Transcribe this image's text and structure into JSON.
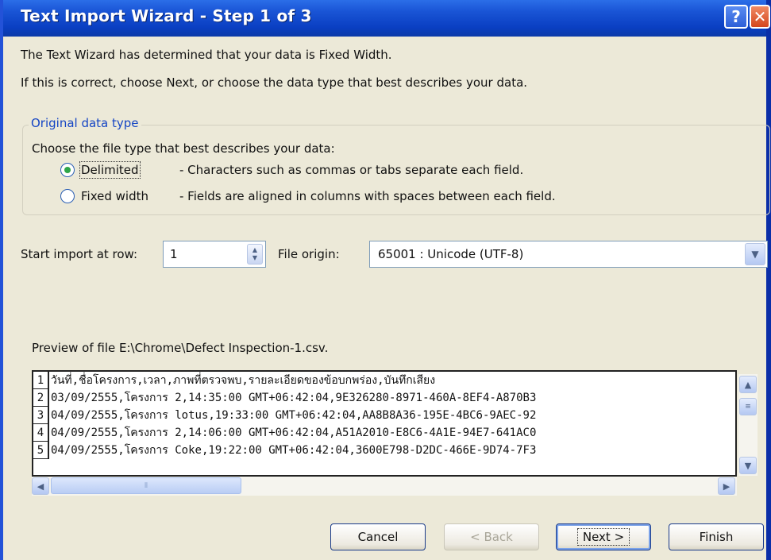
{
  "window": {
    "title": "Text Import Wizard - Step 1 of 3",
    "help_glyph": "?",
    "close_glyph": "✕"
  },
  "intro": {
    "line1": "The Text Wizard has determined that your data is Fixed Width.",
    "line2": "If this is correct, choose Next, or choose the data type that best describes your data."
  },
  "original_data_type": {
    "legend": "Original data type",
    "prompt": "Choose the file type that best describes your data:",
    "options": [
      {
        "label": "Delimited",
        "description": "- Characters such as commas or tabs separate each field.",
        "selected": true
      },
      {
        "label": "Fixed width",
        "description": "- Fields are aligned in columns with spaces between each field.",
        "selected": false
      }
    ]
  },
  "start_row": {
    "label": "Start import at row:",
    "value": "1"
  },
  "file_origin": {
    "label": "File origin:",
    "value": "65001 : Unicode (UTF-8)"
  },
  "preview": {
    "label": "Preview of file E:\\Chrome\\Defect Inspection-1.csv.",
    "rows": [
      {
        "num": "1",
        "text": "วันที่,ชื่อโครงการ,เวลา,ภาพที่ตรวจพบ,รายละเอียดของข้อบกพร่อง,บันทึกเสียง"
      },
      {
        "num": "2",
        "text": "03/09/2555,โครงการ 2,14:35:00 GMT+06:42:04,9E326280-8971-460A-8EF4-A870B3"
      },
      {
        "num": "3",
        "text": "04/09/2555,โครงการ lotus,19:33:00 GMT+06:42:04,AA8B8A36-195E-4BC6-9AEC-92"
      },
      {
        "num": "4",
        "text": "04/09/2555,โครงการ 2,14:06:00 GMT+06:42:04,A51A2010-E8C6-4A1E-94E7-641AC0"
      },
      {
        "num": "5",
        "text": "04/09/2555,โครงการ Coke,19:22:00 GMT+06:42:04,3600E798-D2DC-466E-9D74-7F3"
      }
    ]
  },
  "buttons": {
    "cancel": "Cancel",
    "back": "< Back",
    "next": "Next >",
    "finish": "Finish"
  },
  "colors": {
    "title_bar": "#0a3fc2",
    "dialog_bg": "#ece9d8",
    "group_title": "#1545c4"
  }
}
